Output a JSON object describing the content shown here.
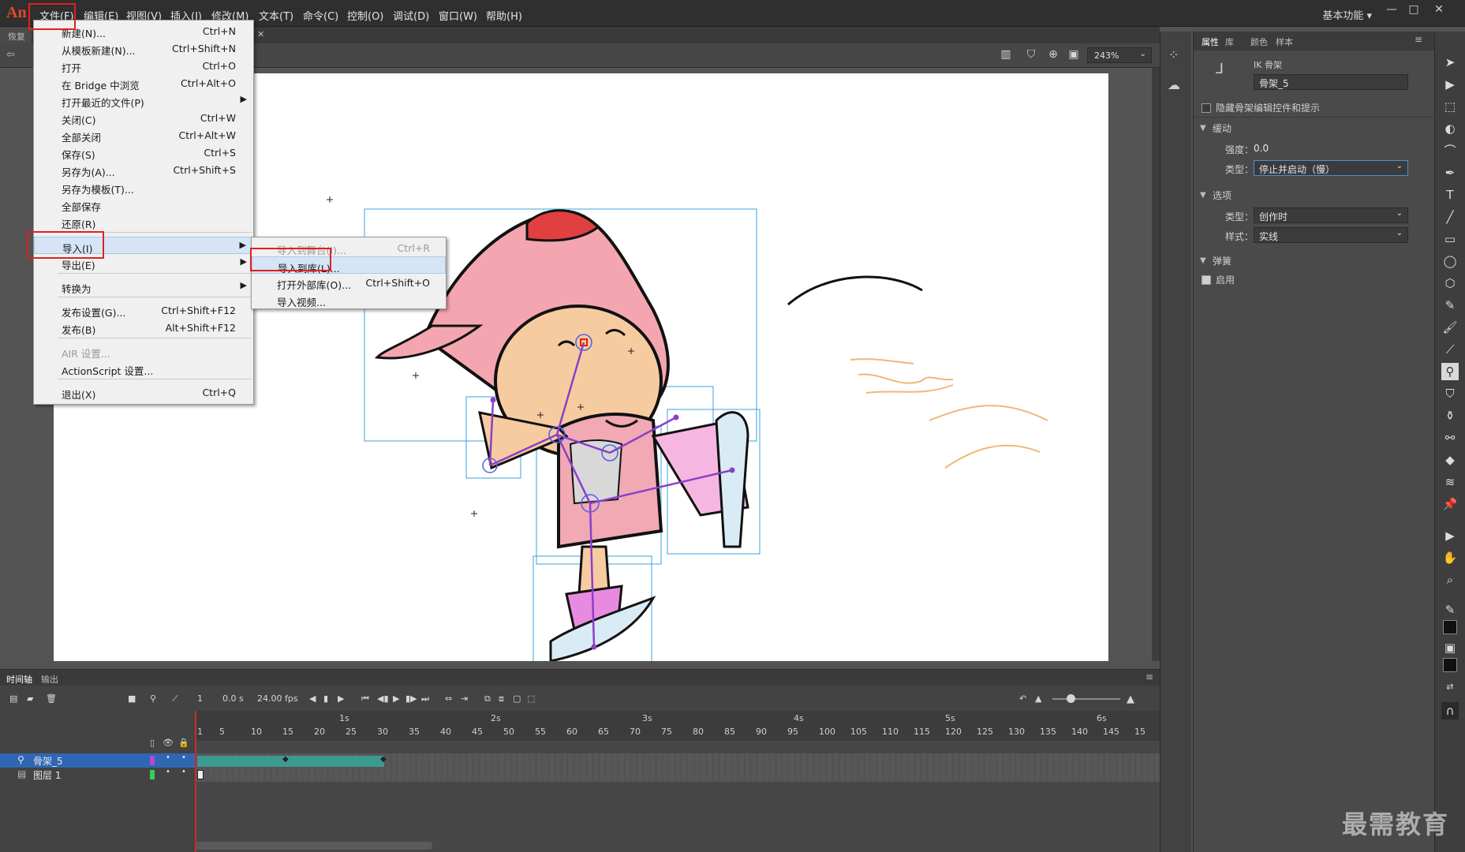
{
  "app": {
    "logo": "An",
    "workspace": "基本功能 ▾"
  },
  "menubar": [
    "文件(F)",
    "编辑(E)",
    "视图(V)",
    "插入(I)",
    "修改(M)",
    "文本(T)",
    "命令(C)",
    "控制(O)",
    "调试(D)",
    "窗口(W)",
    "帮助(H)"
  ],
  "doc_tab": "恢复",
  "zoom": "243%",
  "file_menu": [
    {
      "label": "新建(N)...",
      "sc": "Ctrl+N"
    },
    {
      "label": "从模板新建(N)...",
      "sc": "Ctrl+Shift+N"
    },
    {
      "label": "打开",
      "sc": "Ctrl+O"
    },
    {
      "label": "在 Bridge 中浏览",
      "sc": "Ctrl+Alt+O"
    },
    {
      "label": "打开最近的文件(P)",
      "sc": ""
    },
    {
      "label": "关闭(C)",
      "sc": "Ctrl+W"
    },
    {
      "label": "全部关闭",
      "sc": "Ctrl+Alt+W"
    },
    {
      "label": "保存(S)",
      "sc": "Ctrl+S"
    },
    {
      "label": "另存为(A)...",
      "sc": "Ctrl+Shift+S"
    },
    {
      "label": "另存为模板(T)...",
      "sc": ""
    },
    {
      "label": "全部保存",
      "sc": ""
    },
    {
      "label": "还原(R)",
      "sc": ""
    },
    {
      "label": "导入(I)",
      "sc": ""
    },
    {
      "label": "导出(E)",
      "sc": ""
    },
    {
      "label": "转换为",
      "sc": ""
    },
    {
      "label": "发布设置(G)...",
      "sc": "Ctrl+Shift+F12"
    },
    {
      "label": "发布(B)",
      "sc": "Alt+Shift+F12"
    },
    {
      "label": "AIR 设置...",
      "sc": ""
    },
    {
      "label": "ActionScript 设置...",
      "sc": ""
    },
    {
      "label": "退出(X)",
      "sc": "Ctrl+Q"
    }
  ],
  "import_submenu": [
    {
      "label": "导入到舞台(I)...",
      "sc": "Ctrl+R"
    },
    {
      "label": "导入到库(L)...",
      "sc": ""
    },
    {
      "label": "打开外部库(O)...",
      "sc": "Ctrl+Shift+O"
    },
    {
      "label": "导入视频...",
      "sc": ""
    }
  ],
  "props": {
    "tabs": [
      "属性",
      "库",
      "颜色",
      "样本"
    ],
    "type": "IK 骨架",
    "name": "骨架_5",
    "hide_label": "隐藏骨架编辑控件和提示",
    "ease_section": "缓动",
    "strength_label": "强度：",
    "strength_value": "0.0",
    "ease_type_label": "类型：",
    "ease_type_value": "停止并启动（慢）",
    "options_section": "选项",
    "opt_type_label": "类型：",
    "opt_type_value": "创作时",
    "opt_style_label": "样式：",
    "opt_style_value": "实线",
    "spring_section": "弹簧",
    "enable_label": "启用"
  },
  "timeline": {
    "tabs": [
      "时间轴",
      "输出"
    ],
    "frame": "1",
    "time": "0.0 s",
    "fps": "24.00 fps",
    "seconds": [
      "1s",
      "2s",
      "3s",
      "4s",
      "5s",
      "6s"
    ],
    "ticks": [
      "1",
      "5",
      "10",
      "15",
      "20",
      "25",
      "30",
      "35",
      "40",
      "45",
      "50",
      "55",
      "60",
      "65",
      "70",
      "75",
      "80",
      "85",
      "90",
      "95",
      "100",
      "105",
      "110",
      "115",
      "120",
      "125",
      "130",
      "135",
      "140",
      "145",
      "15"
    ],
    "layers": [
      "骨架_5",
      "图层 1"
    ]
  },
  "watermark": "最需教育",
  "colors": {
    "accent": "#e34a28",
    "span": "#3d9a93",
    "highlight": "#e02020",
    "bone": "#8b3fc9"
  }
}
